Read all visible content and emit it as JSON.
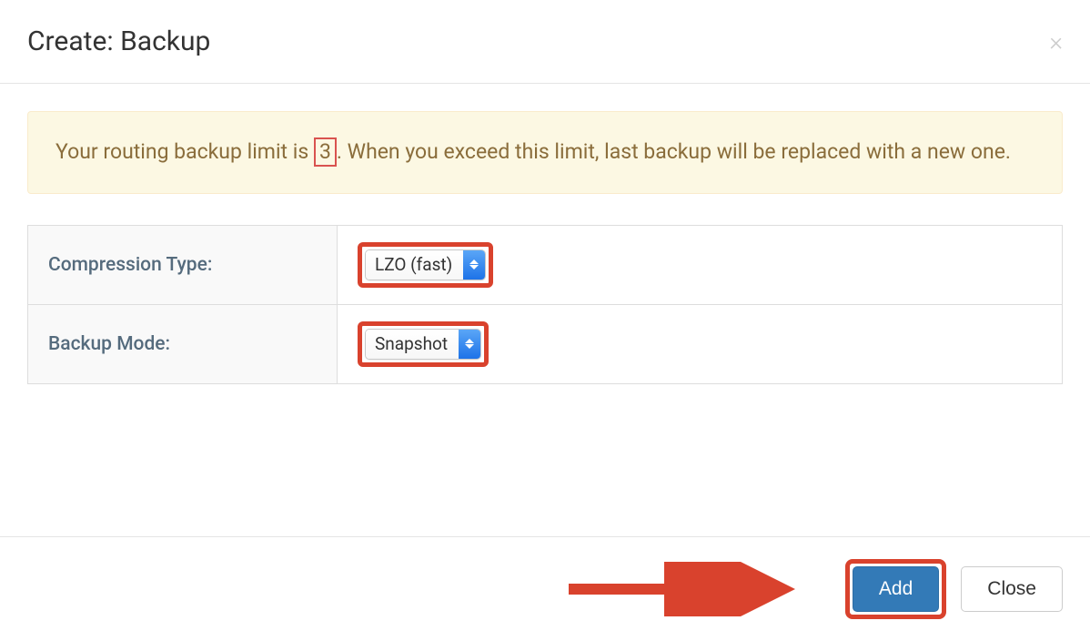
{
  "modal": {
    "title": "Create: Backup",
    "alert": {
      "text_before": "Your routing backup limit is ",
      "limit": "3",
      "text_after": ". When you exceed this limit, last backup will be replaced with a new one."
    },
    "form": {
      "compression_label": "Compression Type:",
      "compression_value": "LZO (fast)",
      "backup_mode_label": "Backup Mode:",
      "backup_mode_value": "Snapshot"
    },
    "footer": {
      "add_button": "Add",
      "close_button": "Close"
    }
  }
}
